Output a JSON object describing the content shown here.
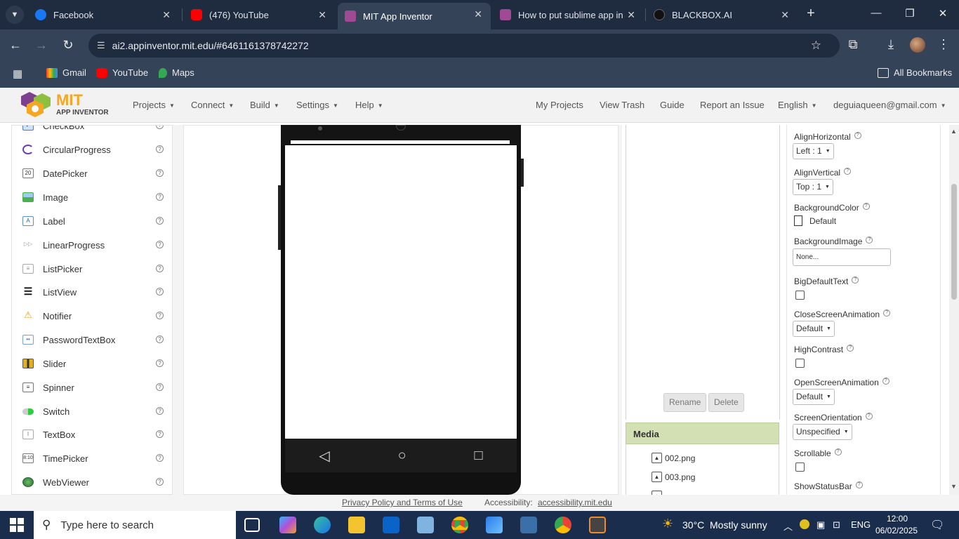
{
  "browser": {
    "tabs": [
      {
        "title": "Facebook",
        "color": "#1877f2"
      },
      {
        "title": "(476) YouTube",
        "color": "#ff0000"
      },
      {
        "title": "MIT App Inventor",
        "color": "#a04a96"
      },
      {
        "title": "How to put sublime app in",
        "color": "#a04a96"
      },
      {
        "title": "BLACKBOX.AI",
        "color": "#111111"
      }
    ],
    "url": "ai2.appinventor.mit.edu/#6461161378742272",
    "bookmarks": [
      "Gmail",
      "YouTube",
      "Maps"
    ],
    "all_bookmarks": "All Bookmarks"
  },
  "app": {
    "logo_title": "MIT",
    "logo_subtitle": "APP INVENTOR",
    "menus": [
      "Projects",
      "Connect",
      "Build",
      "Settings",
      "Help"
    ],
    "right_links": [
      "My Projects",
      "View Trash",
      "Guide",
      "Report an Issue"
    ],
    "language": "English",
    "account": "deguiaqueen@gmail.com"
  },
  "palette": {
    "items": [
      "CheckBox",
      "CircularProgress",
      "DatePicker",
      "Image",
      "Label",
      "LinearProgress",
      "ListPicker",
      "ListView",
      "Notifier",
      "PasswordTextBox",
      "Slider",
      "Spinner",
      "Switch",
      "TextBox",
      "TimePicker",
      "WebViewer"
    ],
    "help_glyph": "?"
  },
  "components": {
    "rename": "Rename",
    "delete": "Delete"
  },
  "media": {
    "header": "Media",
    "files": [
      "002.png",
      "003.png"
    ]
  },
  "properties": {
    "align_horizontal": {
      "label": "AlignHorizontal",
      "value": "Left : 1"
    },
    "align_vertical": {
      "label": "AlignVertical",
      "value": "Top : 1"
    },
    "background_color": {
      "label": "BackgroundColor",
      "value": "Default"
    },
    "background_image": {
      "label": "BackgroundImage",
      "value": "None..."
    },
    "big_default_text": {
      "label": "BigDefaultText",
      "checked": false
    },
    "close_screen_animation": {
      "label": "CloseScreenAnimation",
      "value": "Default"
    },
    "high_contrast": {
      "label": "HighContrast",
      "checked": false
    },
    "open_screen_animation": {
      "label": "OpenScreenAnimation",
      "value": "Default"
    },
    "screen_orientation": {
      "label": "ScreenOrientation",
      "value": "Unspecified"
    },
    "scrollable": {
      "label": "Scrollable",
      "checked": false
    },
    "show_status_bar": {
      "label": "ShowStatusBar"
    }
  },
  "footer": {
    "privacy": "Privacy Policy and Terms of Use",
    "accessibility_label": "Accessibility:",
    "accessibility_link": "accessibility.mit.edu"
  },
  "taskbar": {
    "search_placeholder": "Type here to search",
    "weather_temp": "30°C",
    "weather_text": "Mostly sunny",
    "language": "ENG",
    "time": "12:00",
    "date": "06/02/2025"
  }
}
